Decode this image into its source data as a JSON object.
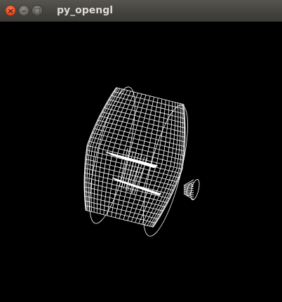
{
  "window": {
    "title": "py_opengl",
    "controls": {
      "close_icon": "close-icon",
      "minimize_icon": "minimize-icon",
      "maximize_icon": "maximize-icon"
    }
  },
  "viewport": {
    "background": "#000000",
    "wire_color": "#ffffff",
    "render_mode": "wireframe"
  },
  "colors": {
    "titlebar": "#4a4944",
    "title_text": "#dfdbd2",
    "close_button": "#e5532b"
  }
}
